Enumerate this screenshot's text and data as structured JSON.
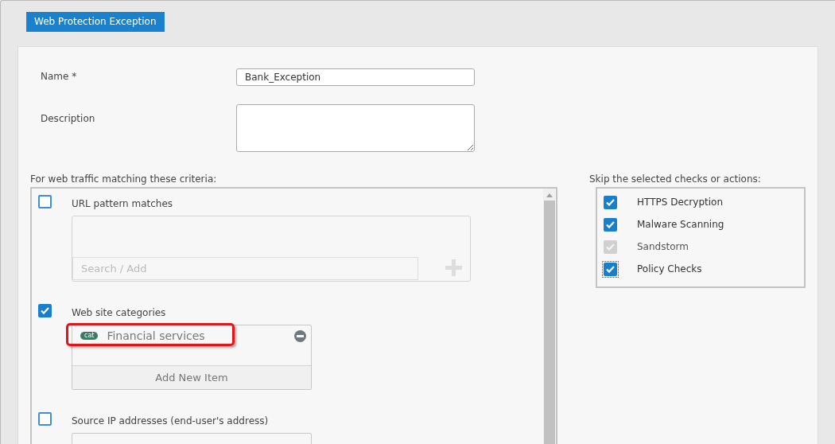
{
  "title_tab": "Web Protection Exception",
  "fields": [
    {
      "label": "Name *",
      "kind": "input",
      "value": "Bank_Exception"
    },
    {
      "label": "Description",
      "kind": "textarea"
    }
  ],
  "criteria": {
    "heading": "For web traffic matching these criteria:",
    "items": [
      {
        "kind": "pattern",
        "label": "URL pattern matches",
        "checked": false,
        "placeholder": "Search / Add"
      },
      {
        "kind": "list",
        "label": "Web site categories",
        "checked": true,
        "entries": [
          {
            "tag": "cat",
            "text": "Financial services",
            "highlighted": true
          }
        ],
        "add_label": "Add New Item"
      },
      {
        "kind": "list_cut",
        "label": "Source IP addresses (end-user's address)",
        "checked": false
      }
    ]
  },
  "skip": {
    "heading": "Skip the selected checks or actions:",
    "items": [
      {
        "label": "HTTPS Decryption",
        "checked": true,
        "disabled": false,
        "focused": false
      },
      {
        "label": "Malware Scanning",
        "checked": true,
        "disabled": false,
        "focused": false
      },
      {
        "label": "Sandstorm",
        "checked": true,
        "disabled": true,
        "focused": false
      },
      {
        "label": "Policy Checks",
        "checked": true,
        "disabled": false,
        "focused": true
      }
    ]
  }
}
